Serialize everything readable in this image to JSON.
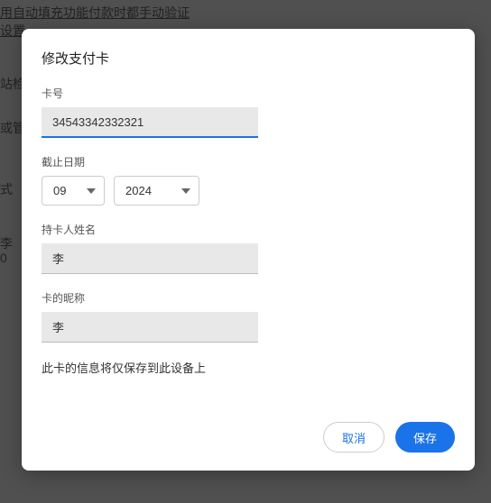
{
  "backdrop": {
    "line1": "用自动填充功能付款时都手动验证",
    "line2": "设置",
    "line3": "站检",
    "line4": "或管",
    "line5": "式",
    "line6": "李",
    "line7": "0"
  },
  "modal": {
    "title": "修改支付卡",
    "card_number": {
      "label": "卡号",
      "value": "34543342332321"
    },
    "expiry": {
      "label": "截止日期",
      "month": "09",
      "year": "2024"
    },
    "cardholder": {
      "label": "持卡人姓名",
      "value": "李"
    },
    "nickname": {
      "label": "卡的昵称",
      "value": "李"
    },
    "info": "此卡的信息将仅保存到此设备上",
    "cancel": "取消",
    "save": "保存"
  }
}
